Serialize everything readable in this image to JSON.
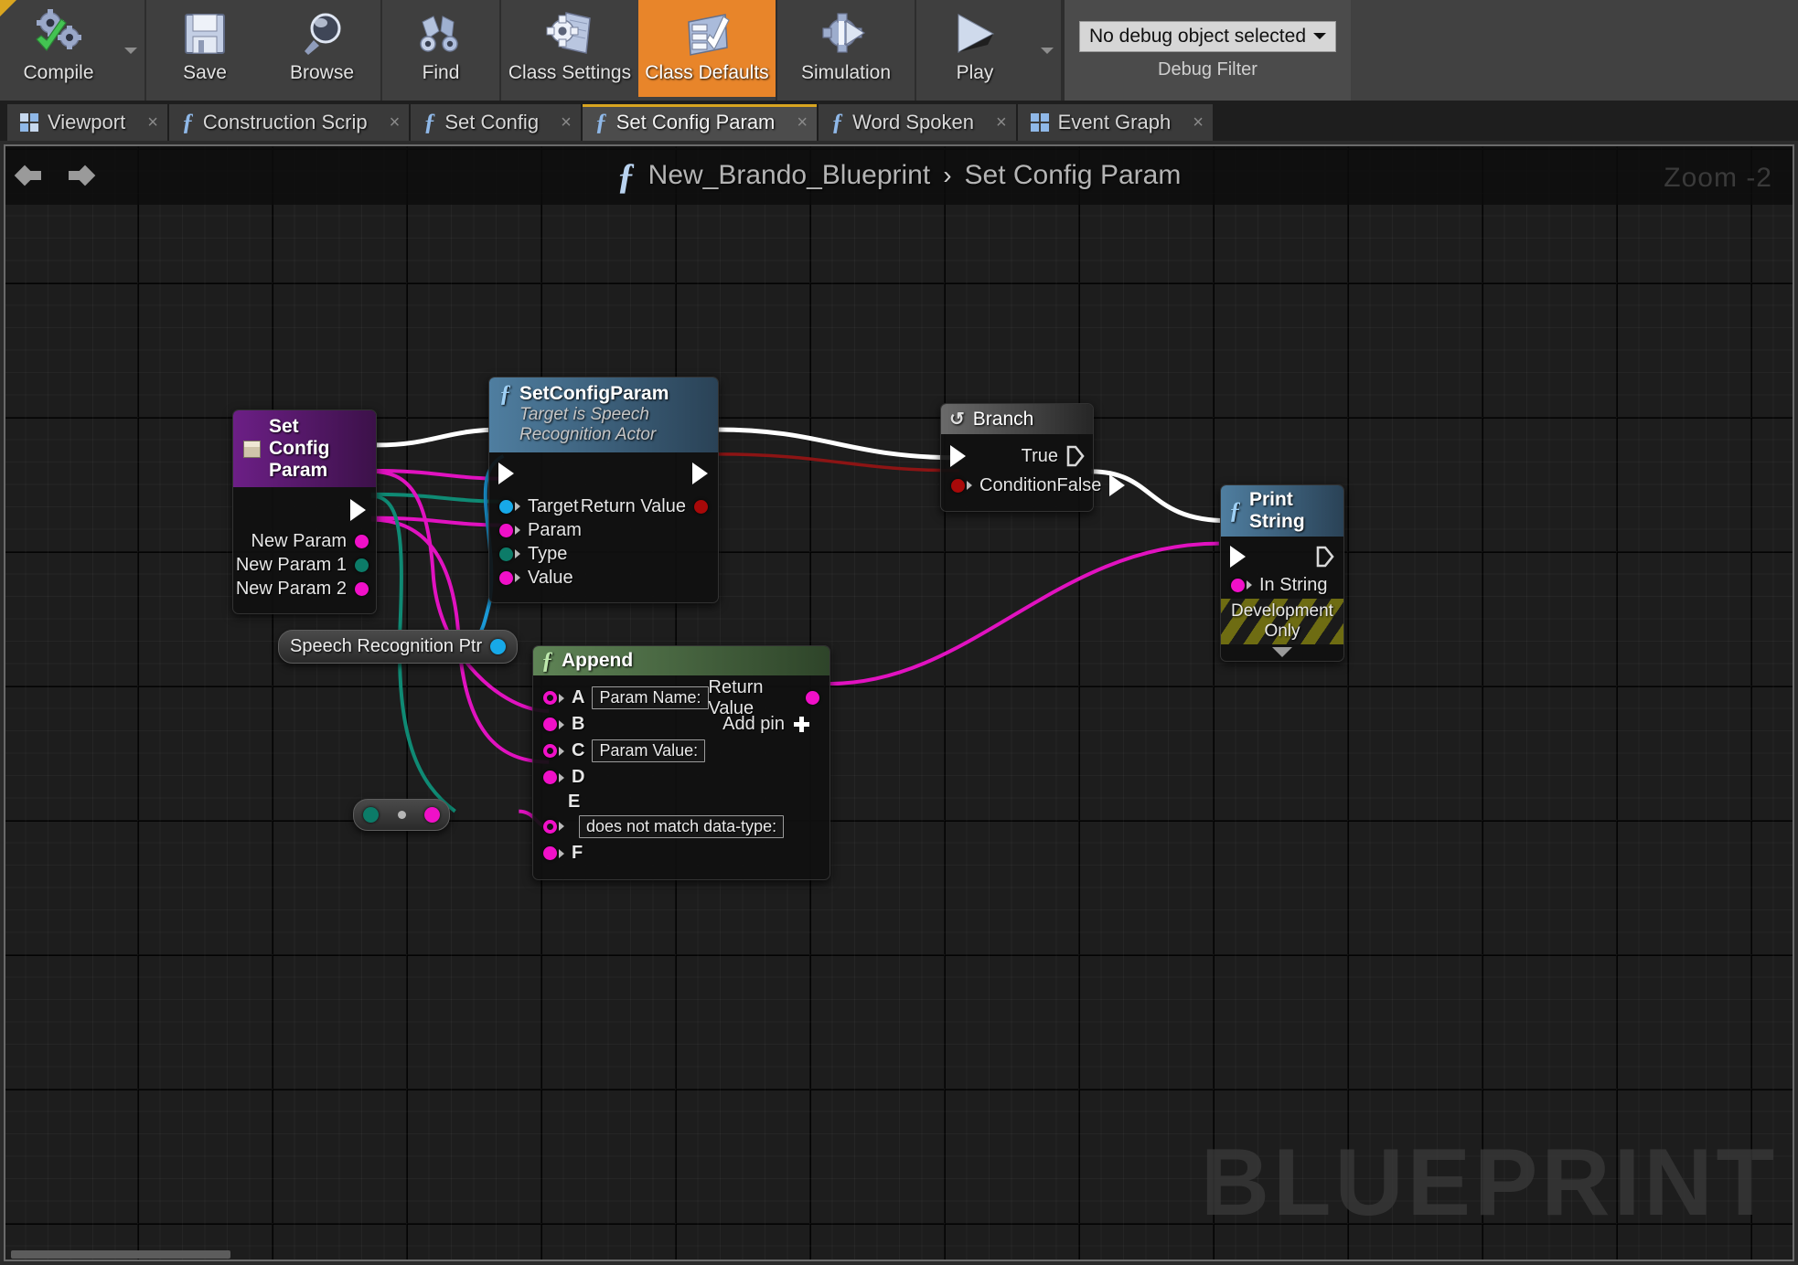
{
  "toolbar": {
    "buttons": [
      {
        "label": "Compile",
        "icon": "compile-gears-check-icon",
        "has_caret": true,
        "active": false
      },
      {
        "label": "Save",
        "icon": "floppy-disk-icon",
        "has_caret": false,
        "active": false
      },
      {
        "label": "Browse",
        "icon": "magnifier-icon",
        "has_caret": false,
        "active": false
      },
      {
        "label": "Find",
        "icon": "binoculars-icon",
        "has_caret": false,
        "active": false
      },
      {
        "label": "Class Settings",
        "icon": "gear-document-icon",
        "has_caret": false,
        "active": false
      },
      {
        "label": "Class Defaults",
        "icon": "checklist-icon",
        "has_caret": false,
        "active": true
      },
      {
        "label": "Simulation",
        "icon": "gear-play-icon",
        "has_caret": false,
        "active": false
      },
      {
        "label": "Play",
        "icon": "play-triangle-icon",
        "has_caret": true,
        "active": false
      }
    ],
    "debug": {
      "value": "No debug object selected",
      "label": "Debug Filter"
    }
  },
  "tabs": [
    {
      "label": "Viewport",
      "icon": "viewport-grid-icon",
      "active": false
    },
    {
      "label": "Construction Scrip",
      "icon": "function-icon",
      "active": false
    },
    {
      "label": "Set Config",
      "icon": "function-icon",
      "active": false
    },
    {
      "label": "Set Config Param",
      "icon": "function-icon",
      "active": true
    },
    {
      "label": "Word Spoken",
      "icon": "function-icon",
      "active": false
    },
    {
      "label": "Event Graph",
      "icon": "graph-grid-icon",
      "active": false
    }
  ],
  "graph": {
    "breadcrumb": {
      "root": "New_Brando_Blueprint",
      "separator": "›",
      "current": "Set Config Param"
    },
    "zoom_label": "Zoom -2",
    "watermark": "BLUEPRINT",
    "close_glyph": "×"
  },
  "nodes": {
    "set_config_param_entry": {
      "title": "Set Config Param",
      "outputs": [
        "New Param",
        "New Param 1",
        "New Param 2"
      ]
    },
    "set_config_param_call": {
      "title": "SetConfigParam",
      "subtitle": "Target is Speech Recognition Actor",
      "inputs": [
        "Target",
        "Param",
        "Type",
        "Value"
      ],
      "outputs": [
        "Return Value"
      ]
    },
    "branch": {
      "title": "Branch",
      "inputs": [
        "Condition"
      ],
      "outputs": [
        "True",
        "False"
      ]
    },
    "print_string": {
      "title": "Print String",
      "inputs": [
        "In String"
      ],
      "footer": "Development Only"
    },
    "append": {
      "title": "Append",
      "inputs": [
        {
          "pin": "A",
          "value": "Param Name:"
        },
        {
          "pin": "B",
          "value": ""
        },
        {
          "pin": "C",
          "value": "Param Value:"
        },
        {
          "pin": "D",
          "value": ""
        },
        {
          "pin": "E",
          "value": "does not match data-type:"
        },
        {
          "pin": "F",
          "value": ""
        }
      ],
      "outputs": [
        "Return Value"
      ],
      "add_pin": "Add pin"
    },
    "speech_recognition_ptr": {
      "title": "Speech Recognition Ptr"
    },
    "conversion_node": {
      "title": ""
    }
  },
  "colors": {
    "accent_orange": "#e8852a",
    "exec_white": "#ffffff",
    "pin_string_magenta": "#f010c8",
    "pin_object_blue": "#17a9e8",
    "pin_enum_teal": "#0c7b68",
    "pin_bool_red": "#a80909",
    "tab_highlight": "#d9a520",
    "graph_bg": "#1d1d1d"
  }
}
